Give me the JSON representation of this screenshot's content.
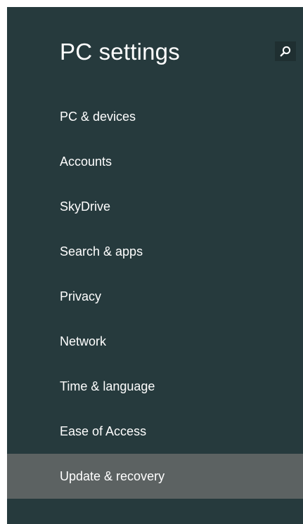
{
  "header": {
    "title": "PC settings",
    "search_icon": "search-icon"
  },
  "nav": {
    "items": [
      {
        "label": "PC & devices",
        "selected": false
      },
      {
        "label": "Accounts",
        "selected": false
      },
      {
        "label": "SkyDrive",
        "selected": false
      },
      {
        "label": "Search & apps",
        "selected": false
      },
      {
        "label": "Privacy",
        "selected": false
      },
      {
        "label": "Network",
        "selected": false
      },
      {
        "label": "Time & language",
        "selected": false
      },
      {
        "label": "Ease of Access",
        "selected": false
      },
      {
        "label": "Update & recovery",
        "selected": true
      }
    ]
  },
  "colors": {
    "background": "#263a3d",
    "selected_background": "#5c6262",
    "text": "#ffffff"
  }
}
